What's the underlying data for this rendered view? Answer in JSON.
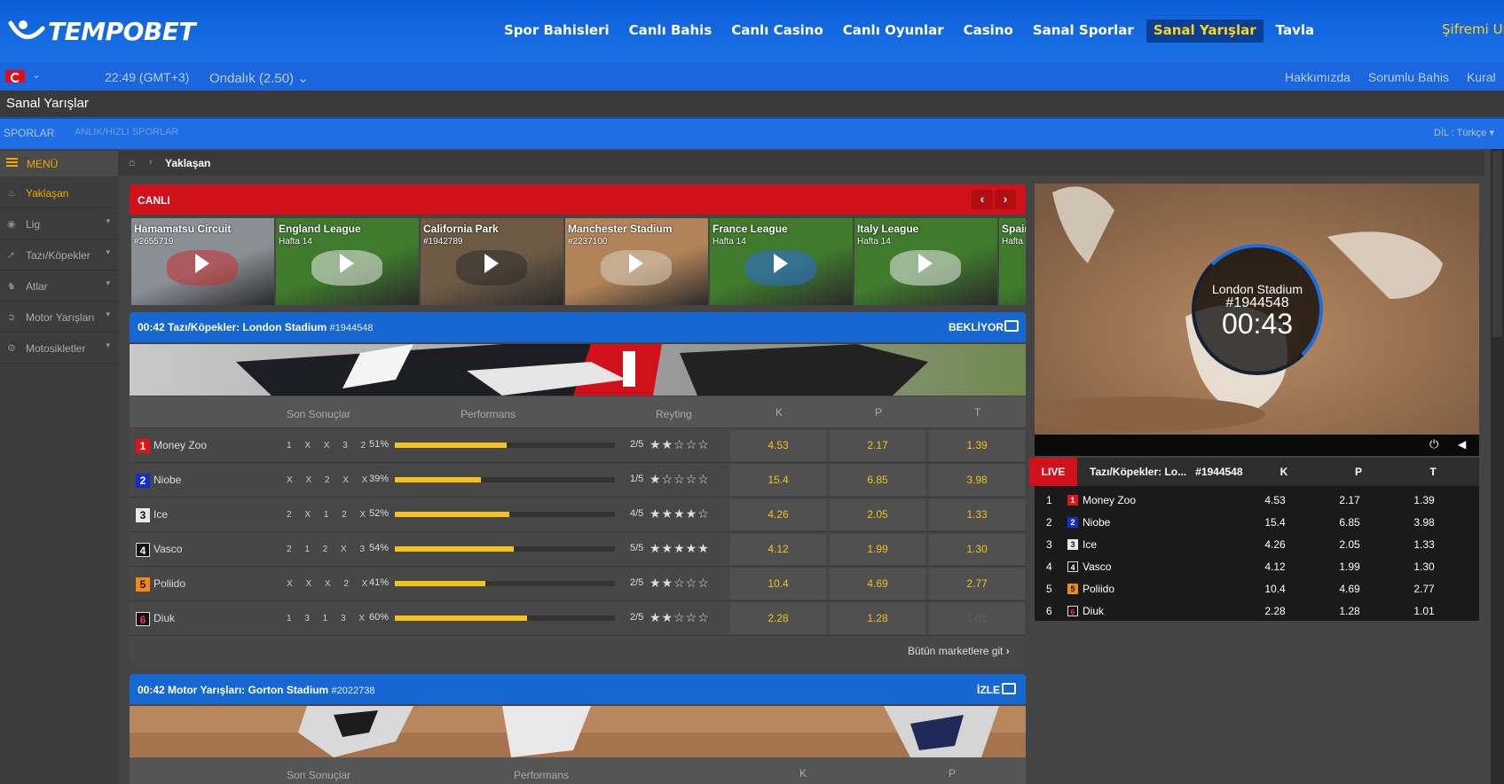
{
  "brand": {
    "name": "TEMPOBET"
  },
  "nav": {
    "items": [
      "Spor Bahisleri",
      "Canlı Bahis",
      "Canlı Casino",
      "Canlı Oyunlar",
      "Casino",
      "Sanal Sporlar",
      "Sanal Yarışlar",
      "Tavla"
    ],
    "active": "Sanal Yarışlar",
    "password_link": "Şifremi Un"
  },
  "subbar": {
    "time": "22:49 (GMT+3)",
    "odds_format": "Ondalık (2.50)",
    "links": [
      "Hakkımızda",
      "Sorumlu Bahis",
      "Kural"
    ]
  },
  "page_title": "Sanal Yarışlar",
  "sportbar": {
    "sports": "SPORLAR",
    "instant": "ANLIK/HIZLI SPORLAR",
    "language": "DİL : Türkçe"
  },
  "sidebar": {
    "menu_label": "MENÜ",
    "items": [
      {
        "label": "Yaklaşan",
        "icon": "fire-icon",
        "active": true
      },
      {
        "label": "Lig",
        "icon": "ball-icon"
      },
      {
        "label": "Tazı/Köpekler",
        "icon": "dog-icon"
      },
      {
        "label": "Atlar",
        "icon": "horse-icon"
      },
      {
        "label": "Motor Yarışları",
        "icon": "motor-icon"
      },
      {
        "label": "Motosikletler",
        "icon": "motorcycle-icon"
      }
    ]
  },
  "breadcrumb": {
    "current": "Yaklaşan"
  },
  "live": {
    "label": "CANLI",
    "events": [
      {
        "title": "Hamamatsu Circuit",
        "sub": "#2655719"
      },
      {
        "title": "England League",
        "sub": "Hafta 14"
      },
      {
        "title": "California Park",
        "sub": "#1942789"
      },
      {
        "title": "Manchester Stadium",
        "sub": "#2237100"
      },
      {
        "title": "France League",
        "sub": "Hafta 14"
      },
      {
        "title": "Italy League",
        "sub": "Hafta 14"
      },
      {
        "title": "Spain",
        "sub": "Hafta"
      }
    ]
  },
  "race1": {
    "title": "00:42 Tazı/Köpekler: London Stadium",
    "id": "#1944548",
    "status": "BEKLİYOR",
    "headers": {
      "results": "Son Sonuçlar",
      "performance": "Performans",
      "rating": "Reyting",
      "k": "K",
      "p": "P",
      "t": "T"
    },
    "runners": [
      {
        "num": "1",
        "name": "Money Zoo",
        "results": "1 X X 3 2",
        "pct": "51%",
        "perf": 0.51,
        "rating": "2/5",
        "stars": "★★☆☆☆",
        "k": "4.53",
        "p": "2.17",
        "t": "1.39",
        "t_disabled": false
      },
      {
        "num": "2",
        "name": "Niobe",
        "results": "X X 2 X X",
        "pct": "39%",
        "perf": 0.39,
        "rating": "1/5",
        "stars": "★☆☆☆☆",
        "k": "15.4",
        "p": "6.85",
        "t": "3.98",
        "t_disabled": false
      },
      {
        "num": "3",
        "name": "Ice",
        "results": "2 X 1 2 X",
        "pct": "52%",
        "perf": 0.52,
        "rating": "4/5",
        "stars": "★★★★☆",
        "k": "4.26",
        "p": "2.05",
        "t": "1.33",
        "t_disabled": false
      },
      {
        "num": "4",
        "name": "Vasco",
        "results": "2 1 2 X 3",
        "pct": "54%",
        "perf": 0.54,
        "rating": "5/5",
        "stars": "★★★★★",
        "k": "4.12",
        "p": "1.99",
        "t": "1.30",
        "t_disabled": false
      },
      {
        "num": "5",
        "name": "Poliido",
        "results": "X X X 2 X",
        "pct": "41%",
        "perf": 0.41,
        "rating": "2/5",
        "stars": "★★☆☆☆",
        "k": "10.4",
        "p": "4.69",
        "t": "2.77",
        "t_disabled": false
      },
      {
        "num": "6",
        "name": "Diuk",
        "results": "1 3 1 3 X",
        "pct": "60%",
        "perf": 0.6,
        "rating": "2/5",
        "stars": "★★☆☆☆",
        "k": "2.28",
        "p": "1.28",
        "t": "1.01",
        "t_disabled": true
      }
    ],
    "all_markets": "Bütün marketlere git"
  },
  "race2": {
    "title": "00:42 Motor Yarışları: Gorton Stadium",
    "id": "#2022738",
    "status": "İZLE",
    "headers": {
      "results": "Son Sonuçlar",
      "performance": "Performans",
      "k": "K",
      "p": "P"
    }
  },
  "video": {
    "venue": "London Stadium",
    "id": "#1944548",
    "clock": "00:43"
  },
  "live_table": {
    "badge": "LIVE",
    "title": "Tazı/Köpekler: Lo...",
    "id": "#1944548",
    "cols": [
      "K",
      "P",
      "T"
    ],
    "rows": [
      {
        "pos": "1",
        "num": "1",
        "name": "Money Zoo",
        "k": "4.53",
        "p": "2.17",
        "t": "1.39"
      },
      {
        "pos": "2",
        "num": "2",
        "name": "Niobe",
        "k": "15.4",
        "p": "6.85",
        "t": "3.98"
      },
      {
        "pos": "3",
        "num": "3",
        "name": "Ice",
        "k": "4.26",
        "p": "2.05",
        "t": "1.33"
      },
      {
        "pos": "4",
        "num": "4",
        "name": "Vasco",
        "k": "4.12",
        "p": "1.99",
        "t": "1.30"
      },
      {
        "pos": "5",
        "num": "5",
        "name": "Poliido",
        "k": "10.4",
        "p": "4.69",
        "t": "2.77"
      },
      {
        "pos": "6",
        "num": "6",
        "name": "Diuk",
        "k": "2.28",
        "p": "1.28",
        "t": "1.01"
      }
    ]
  },
  "colors": {
    "brand_blue": "#1d71e6",
    "accent_yellow": "#f3c21b",
    "live_red": "#d0111b",
    "badge_colors": [
      "#e0131b",
      "#1230c8",
      "#e8e8e8",
      "#111111",
      "#f28a12",
      "#111111"
    ]
  }
}
